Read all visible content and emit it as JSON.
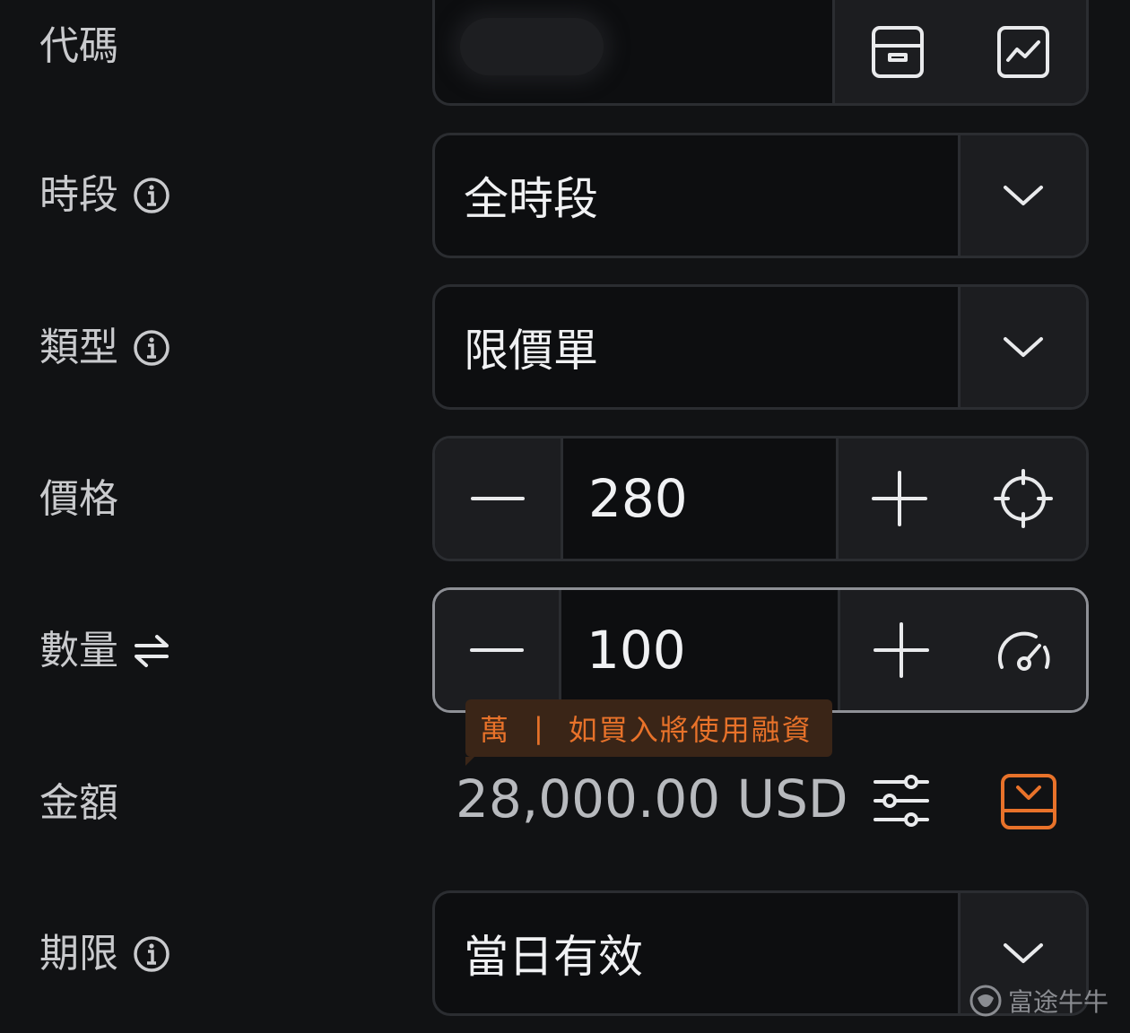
{
  "fields": {
    "code": {
      "label": "代碼"
    },
    "session": {
      "label": "時段",
      "value": "全時段"
    },
    "type": {
      "label": "類型",
      "value": "限價單"
    },
    "price": {
      "label": "價格",
      "value": "280"
    },
    "quantity": {
      "label": "數量",
      "value": "100"
    },
    "amount": {
      "label": "金額",
      "value": "28,000.00 USD"
    },
    "validity": {
      "label": "期限",
      "value": "當日有效"
    }
  },
  "tooltip": {
    "unit": "萬",
    "separator": "|",
    "message": "如買入將使用融資"
  },
  "watermark": {
    "text": "富途牛牛"
  },
  "colors": {
    "background": "#111214",
    "accent_orange": "#e8722a",
    "focus_border": "#8e9096"
  }
}
